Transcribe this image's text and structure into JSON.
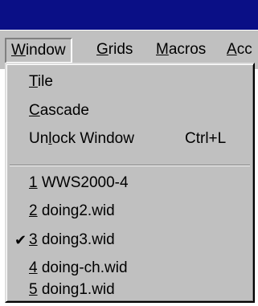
{
  "menubar": {
    "items": [
      {
        "pre": "",
        "mnemonic": "W",
        "post": "indow"
      },
      {
        "pre": "",
        "mnemonic": "G",
        "post": "rids"
      },
      {
        "pre": "",
        "mnemonic": "M",
        "post": "acros"
      },
      {
        "pre": "",
        "mnemonic": "A",
        "post": "cc"
      }
    ]
  },
  "window_menu": {
    "items": [
      {
        "pre": "",
        "mnemonic": "T",
        "post": "ile",
        "shortcut": ""
      },
      {
        "pre": "",
        "mnemonic": "C",
        "post": "ascade",
        "shortcut": ""
      },
      {
        "pre": "Un",
        "mnemonic": "l",
        "post": "ock Window",
        "shortcut": "Ctrl+L"
      }
    ],
    "windows": [
      {
        "number": "1",
        "name": " WWS2000-4",
        "checked": false
      },
      {
        "number": "2",
        "name": " doing2.wid",
        "checked": false
      },
      {
        "number": "3",
        "name": " doing3.wid",
        "checked": true
      },
      {
        "number": "4",
        "name": " doing-ch.wid",
        "checked": false
      },
      {
        "number": "5",
        "name": " doing1.wid",
        "checked": false
      }
    ],
    "check_glyph": "✔"
  },
  "colors": {
    "titlebar": "#0a0f86",
    "menu_face": "#c0c0c0"
  }
}
